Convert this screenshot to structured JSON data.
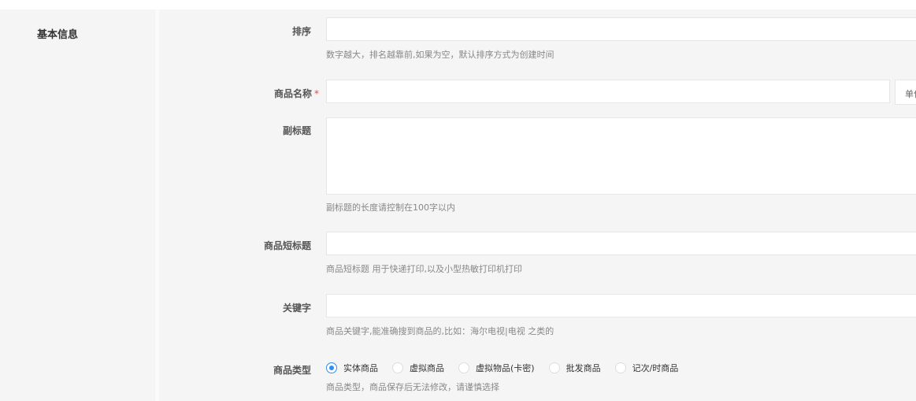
{
  "section": {
    "title": "基本信息"
  },
  "fields": {
    "sort": {
      "label": "排序",
      "value": "",
      "hint": "数字越大，排名越靠前,如果为空，默认排序方式为创建时间"
    },
    "name": {
      "label": "商品名称",
      "required": "*",
      "value": "",
      "unit": "单位"
    },
    "subtitle": {
      "label": "副标题",
      "value": "",
      "hint": "副标题的长度请控制在100字以内"
    },
    "short_title": {
      "label": "商品短标题",
      "value": "",
      "hint": "商品短标题 用于快递打印,以及小型热敏打印机打印"
    },
    "keywords": {
      "label": "关键字",
      "value": "",
      "hint": "商品关键字,能准确搜到商品的,比如：海尔电视|电视 之类的"
    },
    "type": {
      "label": "商品类型",
      "options": [
        "实体商品",
        "虚拟商品",
        "虚拟物品(卡密)",
        "批发商品",
        "记次/时商品"
      ],
      "selected": "实体商品",
      "hint": "商品类型，商品保存后无法修改，请谨慎选择"
    }
  },
  "colors": {
    "accent": "#2f8ff0",
    "required": "#e24a4a"
  }
}
